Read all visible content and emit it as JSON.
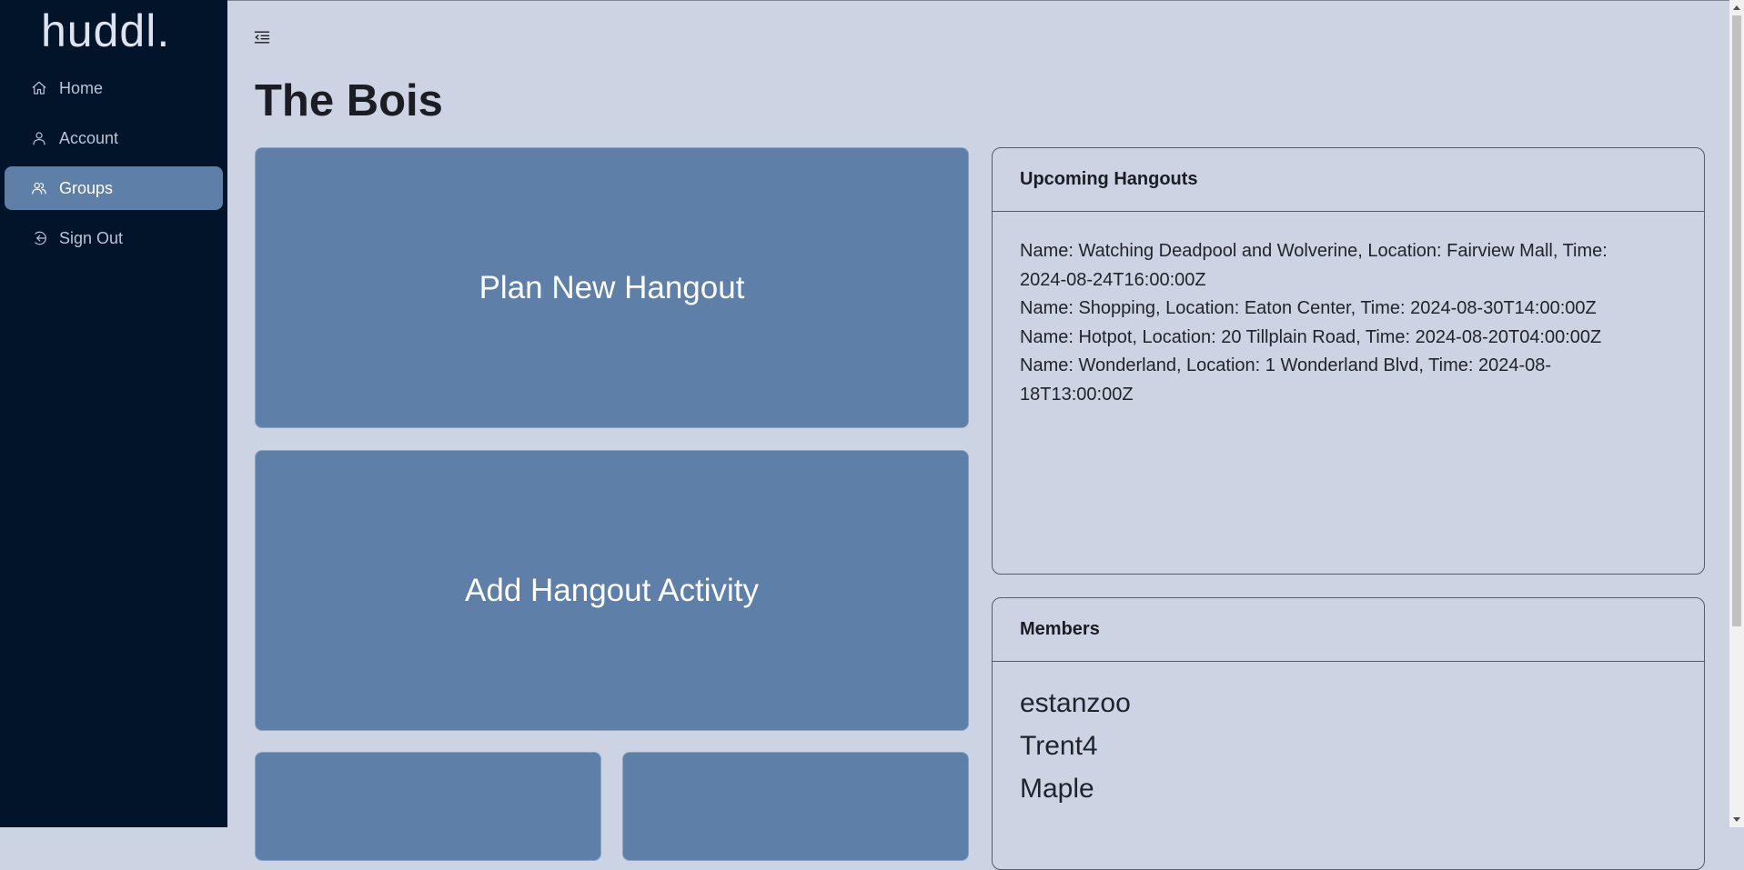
{
  "app": {
    "logo": "huddl."
  },
  "sidebar": {
    "items": [
      {
        "label": "Home",
        "icon": "home-icon"
      },
      {
        "label": "Account",
        "icon": "user-icon"
      },
      {
        "label": "Groups",
        "icon": "users-icon",
        "active": true
      },
      {
        "label": "Sign Out",
        "icon": "sign-out-icon"
      }
    ]
  },
  "page": {
    "title": "The Bois"
  },
  "actions": {
    "plan_label": "Plan New Hangout",
    "add_label": "Add Hangout Activity"
  },
  "hangouts": {
    "title": "Upcoming Hangouts",
    "lines": [
      "Name: Watching Deadpool and Wolverine, Location: Fairview Mall, Time:",
      "2024-08-24T16:00:00Z",
      "Name: Shopping, Location: Eaton Center, Time: 2024-08-30T14:00:00Z",
      "Name: Hotpot, Location: 20 Tillplain Road, Time: 2024-08-20T04:00:00Z",
      "Name: Wonderland, Location: 1 Wonderland Blvd, Time: 2024-08-",
      "18T13:00:00Z"
    ]
  },
  "members": {
    "title": "Members",
    "names": [
      "estanzoo",
      "Trent4",
      "Maple"
    ]
  },
  "colors": {
    "sidebar_bg": "#01142a",
    "page_bg": "#ccd3e3",
    "accent": "#5d7fa8"
  }
}
